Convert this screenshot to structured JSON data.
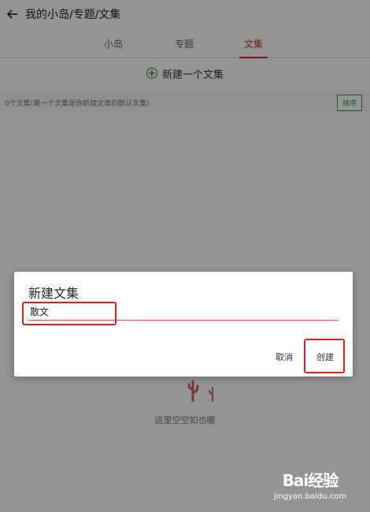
{
  "header": {
    "title": "我的小岛/专题/文集"
  },
  "tabs": [
    {
      "label": "小岛",
      "active": false
    },
    {
      "label": "专题",
      "active": false
    },
    {
      "label": "文集",
      "active": true
    }
  ],
  "new_collection": {
    "label": "新建一个文集"
  },
  "info_row": {
    "text": "0个文集(第一个文集是你新建文章的默认文集)",
    "sort_label": "排序"
  },
  "empty_state": {
    "text": "这里空空如也喔"
  },
  "dialog": {
    "title": "新建文集",
    "input_value": "散文",
    "cancel_label": "取消",
    "create_label": "创建"
  },
  "watermark": {
    "logo": "Bai经验",
    "url": "jingyan.baidu.com"
  },
  "colors": {
    "accent_red": "#c0392b",
    "accent_green": "#3a9a45",
    "highlight": "#e02020"
  },
  "icons": [
    "back-arrow-icon",
    "plus-circle-icon",
    "cactus-icon"
  ]
}
